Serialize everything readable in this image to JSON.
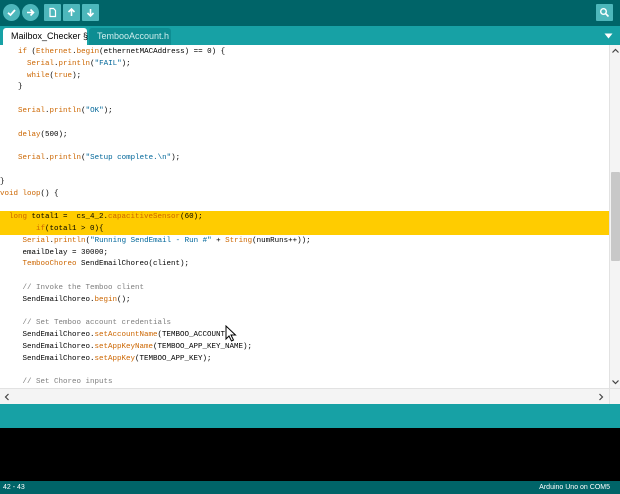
{
  "toolbar": {
    "buttons": [
      {
        "name": "verify-button",
        "icon": "check-icon"
      },
      {
        "name": "upload-button",
        "icon": "arrow-right-icon"
      },
      {
        "name": "new-button",
        "icon": "new-file-icon"
      },
      {
        "name": "open-button",
        "icon": "arrow-up-icon"
      },
      {
        "name": "save-button",
        "icon": "arrow-down-icon"
      }
    ],
    "serial_monitor_icon": "magnifier-icon"
  },
  "tabs": [
    {
      "label": "Mailbox_Checker §",
      "active": true
    },
    {
      "label": "TembooAccount.h",
      "active": false
    }
  ],
  "tab_menu_icon": "triangle-down-icon",
  "code": {
    "lines": [
      {
        "text": "    if (Ethernet.begin(ethernetMACAddress) == 0) {",
        "highlight": false
      },
      {
        "text": "      Serial.println(\"FAIL\");",
        "highlight": false
      },
      {
        "text": "      while(true);",
        "highlight": false
      },
      {
        "text": "    }",
        "highlight": false
      },
      {
        "text": "",
        "highlight": false
      },
      {
        "text": "    Serial.println(\"OK\");",
        "highlight": false
      },
      {
        "text": "",
        "highlight": false
      },
      {
        "text": "    delay(500);",
        "highlight": false
      },
      {
        "text": "",
        "highlight": false
      },
      {
        "text": "    Serial.println(\"Setup complete.\\n\");",
        "highlight": false
      },
      {
        "text": "",
        "highlight": false
      },
      {
        "text": "}",
        "highlight": false
      },
      {
        "text": "void loop() {",
        "highlight": false
      },
      {
        "text": "",
        "highlight": false
      },
      {
        "text": "  long total1 =  cs_4_2.capacitiveSensor(60);",
        "highlight": true
      },
      {
        "text": "        if(total1 > 0){",
        "highlight": true
      },
      {
        "text": "     Serial.println(\"Running SendEmail - Run #\" + String(numRuns++));",
        "highlight": false
      },
      {
        "text": "     emailDelay = 30000;",
        "highlight": false
      },
      {
        "text": "     TembooChoreo SendEmailChoreo(client);",
        "highlight": false
      },
      {
        "text": "",
        "highlight": false
      },
      {
        "text": "     // Invoke the Temboo client",
        "highlight": false
      },
      {
        "text": "     SendEmailChoreo.begin();",
        "highlight": false
      },
      {
        "text": "",
        "highlight": false
      },
      {
        "text": "     // Set Temboo account credentials",
        "highlight": false
      },
      {
        "text": "     SendEmailChoreo.setAccountName(TEMBOO_ACCOUNT);",
        "highlight": false
      },
      {
        "text": "     SendEmailChoreo.setAppKeyName(TEMBOO_APP_KEY_NAME);",
        "highlight": false
      },
      {
        "text": "     SendEmailChoreo.setAppKey(TEMBOO_APP_KEY);",
        "highlight": false
      },
      {
        "text": "",
        "highlight": false
      },
      {
        "text": "     // Set Choreo inputs",
        "highlight": false
      }
    ]
  },
  "scroll": {
    "thumb_start": 0.36,
    "thumb_end": 0.64
  },
  "status": {
    "line_number": "42 - 43",
    "board": "Arduino Uno on COM5"
  },
  "colors": {
    "toolbar": "#006468",
    "tabbar": "#17a1a5",
    "highlight": "#ffcc00",
    "keyword": "#cc6600",
    "console": "#000000"
  }
}
